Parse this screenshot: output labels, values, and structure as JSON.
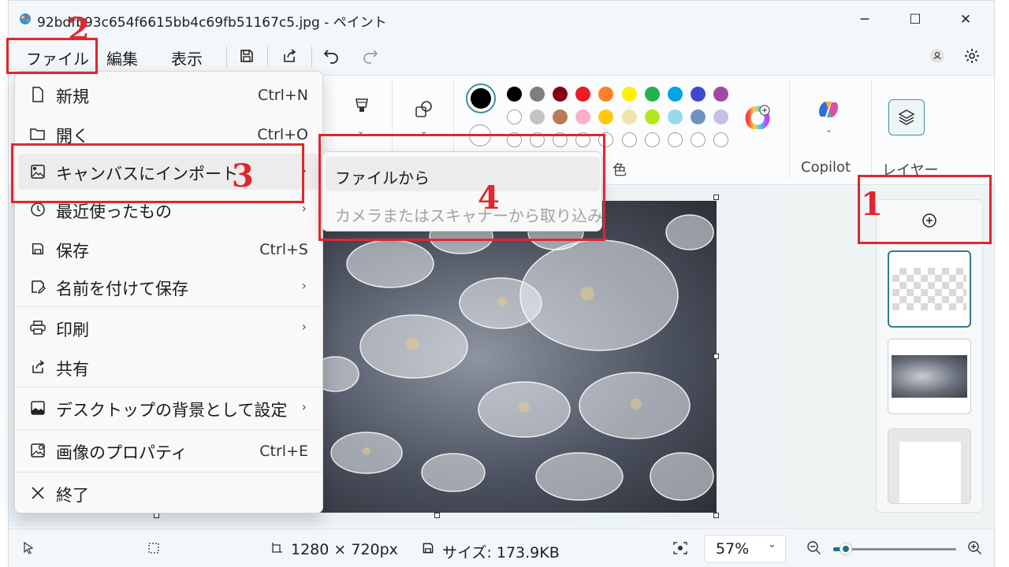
{
  "title": "92bdfb93c654f6615bb4c69fb51167c5.jpg - ペイント",
  "window_controls": {
    "minimize": "─",
    "maximize": "☐",
    "close": "✕"
  },
  "menubar": {
    "file": "ファイル",
    "edit": "編集",
    "view": "表示"
  },
  "ribbon": {
    "color_label": "色",
    "copilot_label": "Copilot",
    "layers_label": "レイヤー",
    "colors_row1": [
      "#000000",
      "#7f7f7f",
      "#880015",
      "#ed1c24",
      "#ff7f27",
      "#fff200",
      "#22b14c",
      "#00a2e8",
      "#3f48cc",
      "#a349a4"
    ],
    "colors_row2": [
      "#ffffff",
      "#c3c3c3",
      "#b97a57",
      "#ffaec9",
      "#ffc90e",
      "#efe4b0",
      "#b5e61d",
      "#99d9ea",
      "#7092be",
      "#c8bfe7"
    ]
  },
  "file_menu": {
    "items": [
      {
        "label": "新規",
        "accel": "Ctrl+N",
        "icon": "new-file-icon"
      },
      {
        "label": "開く",
        "accel": "Ctrl+O",
        "icon": "open-folder-icon"
      },
      {
        "label": "キャンバスにインポート",
        "accel": "",
        "icon": "import-image-icon"
      },
      {
        "label": "最近使ったもの",
        "accel": "",
        "icon": "recent-clock-icon"
      },
      {
        "label": "保存",
        "accel": "Ctrl+S",
        "icon": "save-icon"
      },
      {
        "label": "名前を付けて保存",
        "accel": "",
        "icon": "save-as-icon"
      },
      {
        "label": "印刷",
        "accel": "",
        "icon": "print-icon"
      },
      {
        "label": "共有",
        "accel": "",
        "icon": "share-icon"
      },
      {
        "label": "デスクトップの背景として設定",
        "accel": "",
        "icon": "desktop-background-icon"
      },
      {
        "label": "画像のプロパティ",
        "accel": "Ctrl+E",
        "icon": "image-properties-icon"
      },
      {
        "label": "終了",
        "accel": "",
        "icon": "close-icon"
      }
    ]
  },
  "import_submenu": {
    "from_file": "ファイルから",
    "from_camera": "カメラまたはスキャナーから取り込み"
  },
  "statusbar": {
    "dimensions": "1280 × 720px",
    "size": "サイズ: 173.9KB",
    "zoom": "57%",
    "zoom_fraction": 0.08
  },
  "annotations": [
    "1",
    "2",
    "3",
    "4"
  ]
}
